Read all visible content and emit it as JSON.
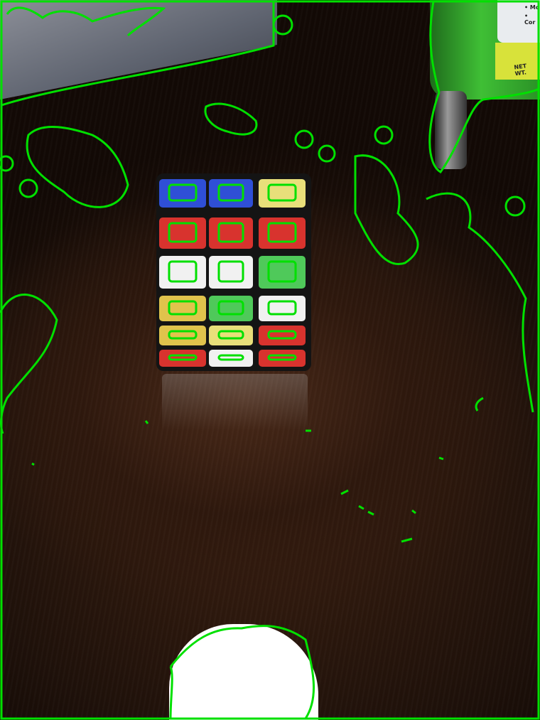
{
  "photo": {
    "subject": "rubiks-cube-on-wooden-table",
    "bottle_label_lines": [
      "• Mo",
      "• Cor",
      "NET WT."
    ]
  },
  "cube": {
    "rows": [
      [
        "#2f4fd6",
        "#2f4fd6",
        "#e8df7a"
      ],
      [
        "#d8332e",
        "#d8332e",
        "#d8332e"
      ],
      [
        "#f1f1f1",
        "#f1f1f1",
        "#4fc95a"
      ],
      [
        "#e0c34c",
        "#4fc95a",
        "#f1f1f1"
      ],
      [
        "#e0c34c",
        "#e8df7a",
        "#d8332e"
      ],
      [
        "#d8332e",
        "#f1f1f1",
        "#d8332e"
      ]
    ]
  },
  "colors": {
    "contour": "#00e000",
    "wood": "#2e180d"
  }
}
